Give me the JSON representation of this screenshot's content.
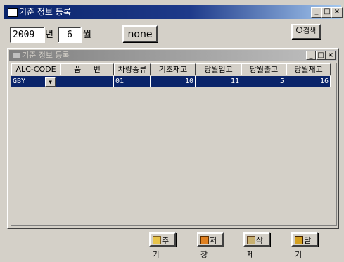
{
  "window": {
    "title": "기준 정보 등록"
  },
  "filter": {
    "year": "2009",
    "year_unit": "년",
    "month": "6",
    "month_unit": "월",
    "none_label": "none",
    "search_label": "검색"
  },
  "inner_window": {
    "title": "기준 정보 등록"
  },
  "grid": {
    "columns": [
      "ALC-CODE",
      "품     번",
      "차량종류",
      "기초재고",
      "당월입고",
      "당월출고",
      "당월재고"
    ],
    "rows": [
      {
        "alc_code": "GBY",
        "part_no": "",
        "vehicle_type": "01",
        "base_stock": "10",
        "month_in": "11",
        "month_out": "5",
        "month_stock": "16"
      }
    ]
  },
  "buttons": {
    "add": "추가",
    "save": "저장",
    "delete": "삭제",
    "close": "닫기"
  },
  "colors": {
    "title_active": "#0a246a",
    "selection": "#0a246a",
    "face": "#d4d0c8"
  }
}
